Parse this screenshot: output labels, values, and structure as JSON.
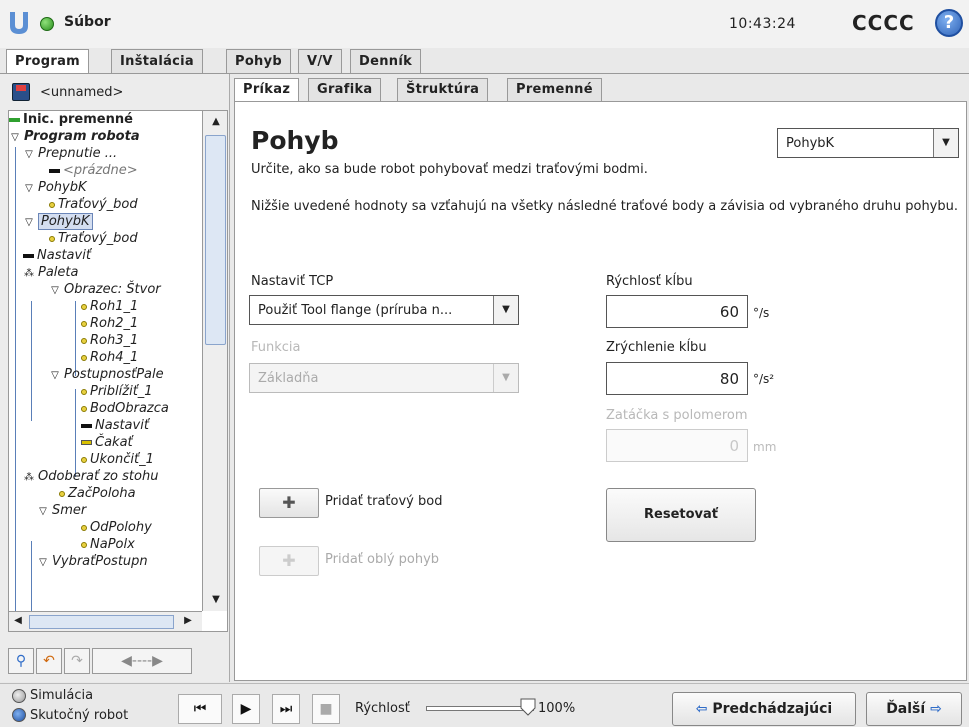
{
  "header": {
    "file_menu": "Súbor",
    "time": "10:43:24",
    "robot_name": "CCCC",
    "help_label": "?"
  },
  "main_tabs": [
    "Program",
    "Inštalácia",
    "Pohyb",
    "V/V",
    "Denník"
  ],
  "program_name": "<unnamed>",
  "tree": [
    {
      "label": "Inic. premenné",
      "icon": "var"
    },
    {
      "label": "Program robota",
      "icon": "tri"
    },
    {
      "label": "Prepnutie ...",
      "icon": "tri"
    },
    {
      "label": "<prázdne>",
      "icon": "bar"
    },
    {
      "label": "PohybK",
      "icon": "tri"
    },
    {
      "label": "Traťový_bod",
      "icon": "dot"
    },
    {
      "label": "PohybK",
      "icon": "tri"
    },
    {
      "label": "Traťový_bod",
      "icon": "dot"
    },
    {
      "label": "Nastaviť",
      "icon": "bar"
    },
    {
      "label": "Paleta",
      "icon": "dots"
    },
    {
      "label": "Obrazec: Štvor",
      "icon": "tri"
    },
    {
      "label": "Roh1_1",
      "icon": "dot"
    },
    {
      "label": "Roh2_1",
      "icon": "dot"
    },
    {
      "label": "Roh3_1",
      "icon": "dot"
    },
    {
      "label": "Roh4_1",
      "icon": "dot"
    },
    {
      "label": "PostupnosťPale",
      "icon": "tri"
    },
    {
      "label": "Priblížiť_1",
      "icon": "dot"
    },
    {
      "label": "BodObrazca",
      "icon": "dot"
    },
    {
      "label": "Nastaviť",
      "icon": "bar"
    },
    {
      "label": "Čakať",
      "icon": "ybar"
    },
    {
      "label": "Ukončiť_1",
      "icon": "dot"
    },
    {
      "label": "Odoberať zo stohu",
      "icon": "dots"
    },
    {
      "label": "ZačPoloha",
      "icon": "dot"
    },
    {
      "label": "Smer",
      "icon": "tri"
    },
    {
      "label": "OdPolohy",
      "icon": "dot"
    },
    {
      "label": "NaPolx",
      "icon": "dot"
    },
    {
      "label": "VybraťPostupn",
      "icon": "tri"
    }
  ],
  "left_tools": {
    "search": "search-icon",
    "undo": "undo-icon",
    "redo": "redo-icon",
    "move": "arrows-icon"
  },
  "sub_tabs": [
    "Príkaz",
    "Grafika",
    "Štruktúra",
    "Premenné"
  ],
  "command": {
    "title": "Pohyb",
    "description": "Určite, ako sa bude robot pohybovať medzi traťovými bodmi.",
    "note": "Nižšie uvedené hodnoty sa vzťahujú na všetky následné traťové body a závisia od vybraného druhu pohybu.",
    "motion_type": "PohybK",
    "tcp_label": "Nastaviť TCP",
    "tcp_value": "Použiť Tool flange (príruba n...",
    "feature_label": "Funkcia",
    "feature_value": "Základňa",
    "joint_speed_label": "Rýchlosť kĺbu",
    "joint_speed_value": "60",
    "joint_speed_unit": "°/s",
    "joint_accel_label": "Zrýchlenie kĺbu",
    "joint_accel_value": "80",
    "joint_accel_unit": "°/s²",
    "blend_label": "Zatáčka s polomerom",
    "blend_value": "0",
    "blend_unit": "mm",
    "add_waypoint_label": "Pridať traťový bod",
    "add_circle_label": "Pridať oblý pohyb",
    "reset_label": "Resetovať"
  },
  "bottom": {
    "simulation": "Simulácia",
    "real_robot": "Skutočný robot",
    "speed_label": "Rýchlosť",
    "speed_value": "100%",
    "speed_fraction": 1.0,
    "prev_label": "Predchádzajúci",
    "next_label": "Ďalší"
  }
}
